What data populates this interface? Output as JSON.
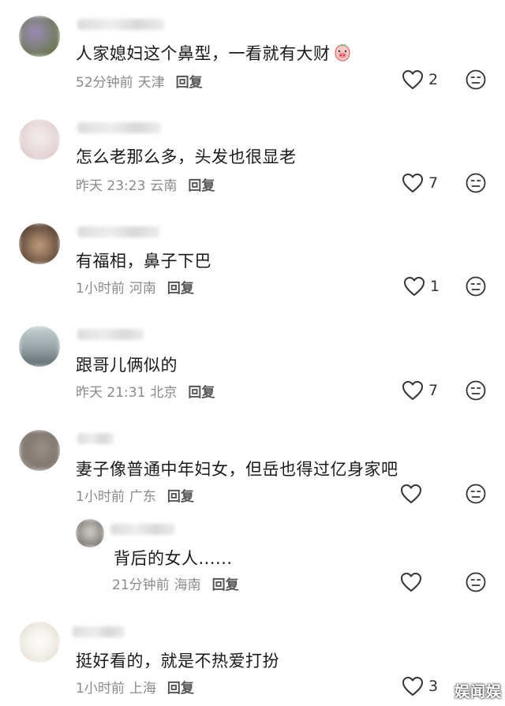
{
  "comments": [
    {
      "text": "人家媳妇这个鼻型，一看就有大财",
      "time": "52分钟前",
      "location": "天津",
      "reply": "回复",
      "likes": "2",
      "emoji": "pig-face-emoji"
    },
    {
      "text": "怎么老那么多，头发也很显老",
      "time": "昨天 23:23",
      "location": "云南",
      "reply": "回复",
      "likes": "7"
    },
    {
      "text": "有福相，鼻子下巴",
      "time": "1小时前",
      "location": "河南",
      "reply": "回复",
      "likes": "1"
    },
    {
      "text": "跟哥儿俩似的",
      "time": "昨天 21:31",
      "location": "北京",
      "reply": "回复",
      "likes": "7"
    },
    {
      "text": "妻子像普通中年妇女，但岳也得过亿身家吧",
      "time": "1小时前",
      "location": "广东",
      "reply": "回复",
      "likes": ""
    },
    {
      "text": "背后的女人......",
      "time": "21分钟前",
      "location": "海南",
      "reply": "回复",
      "likes": "",
      "nested": true
    },
    {
      "text": "挺好看的，就是不热爱打扮",
      "time": "1小时前",
      "location": "上海",
      "reply": "回复",
      "likes": "3"
    }
  ],
  "icons": {
    "like": "heart-outline-icon",
    "dislike": "meh-face-icon"
  },
  "watermark": "娱闻娱",
  "colors": {
    "text": "#1a1a1a",
    "meta": "#8a8a8a",
    "reply": "#555555"
  }
}
